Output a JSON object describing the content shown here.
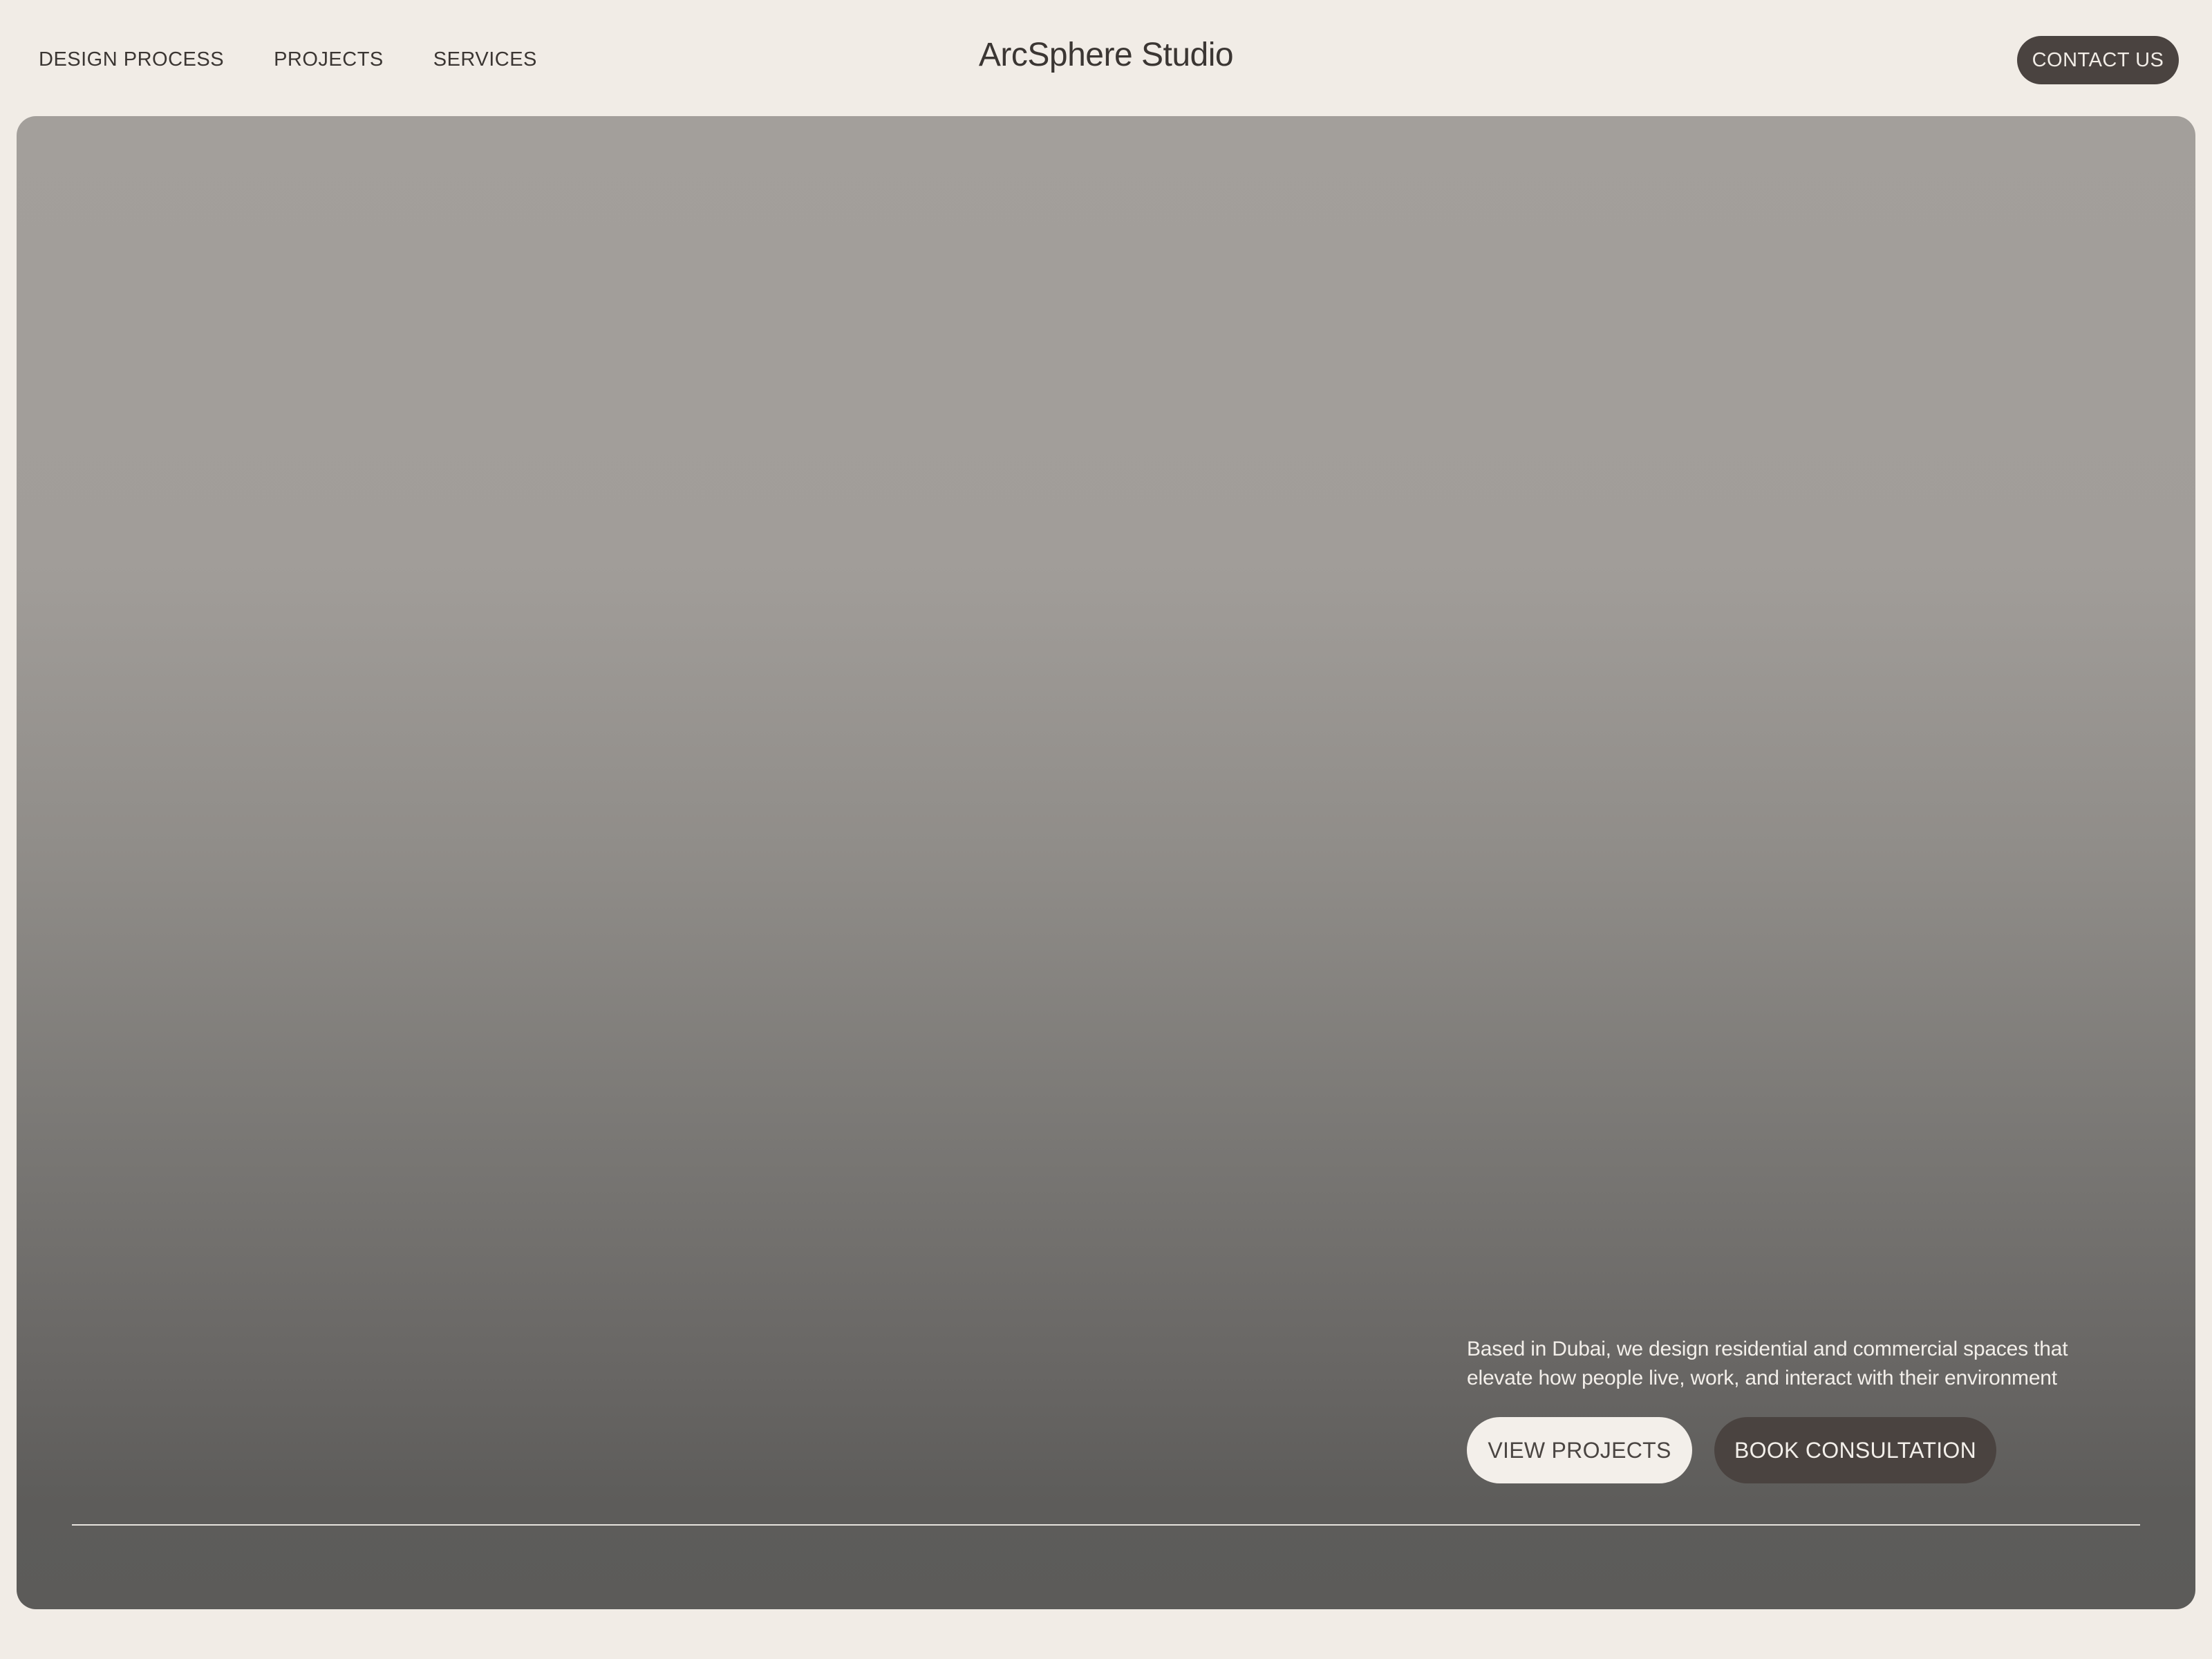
{
  "header": {
    "nav": [
      {
        "label": "DESIGN PROCESS"
      },
      {
        "label": "PROJECTS"
      },
      {
        "label": "SERVICES"
      }
    ],
    "brand": "ArcSphere Studio",
    "contact_label": "CONTACT US"
  },
  "hero": {
    "description_lines": [
      "Based in Dubai, we design residential and commercial spaces that",
      "elevate how people live, work, and interact with their environment"
    ],
    "primary_button": "VIEW PROJECTS",
    "secondary_button": "BOOK CONSULTATION"
  },
  "colors": {
    "background": "#f1ece6",
    "dark_button": "#4a4340",
    "hero_top": "#a39f9b",
    "hero_bottom": "#5c5b59",
    "text": "#3b3633"
  }
}
